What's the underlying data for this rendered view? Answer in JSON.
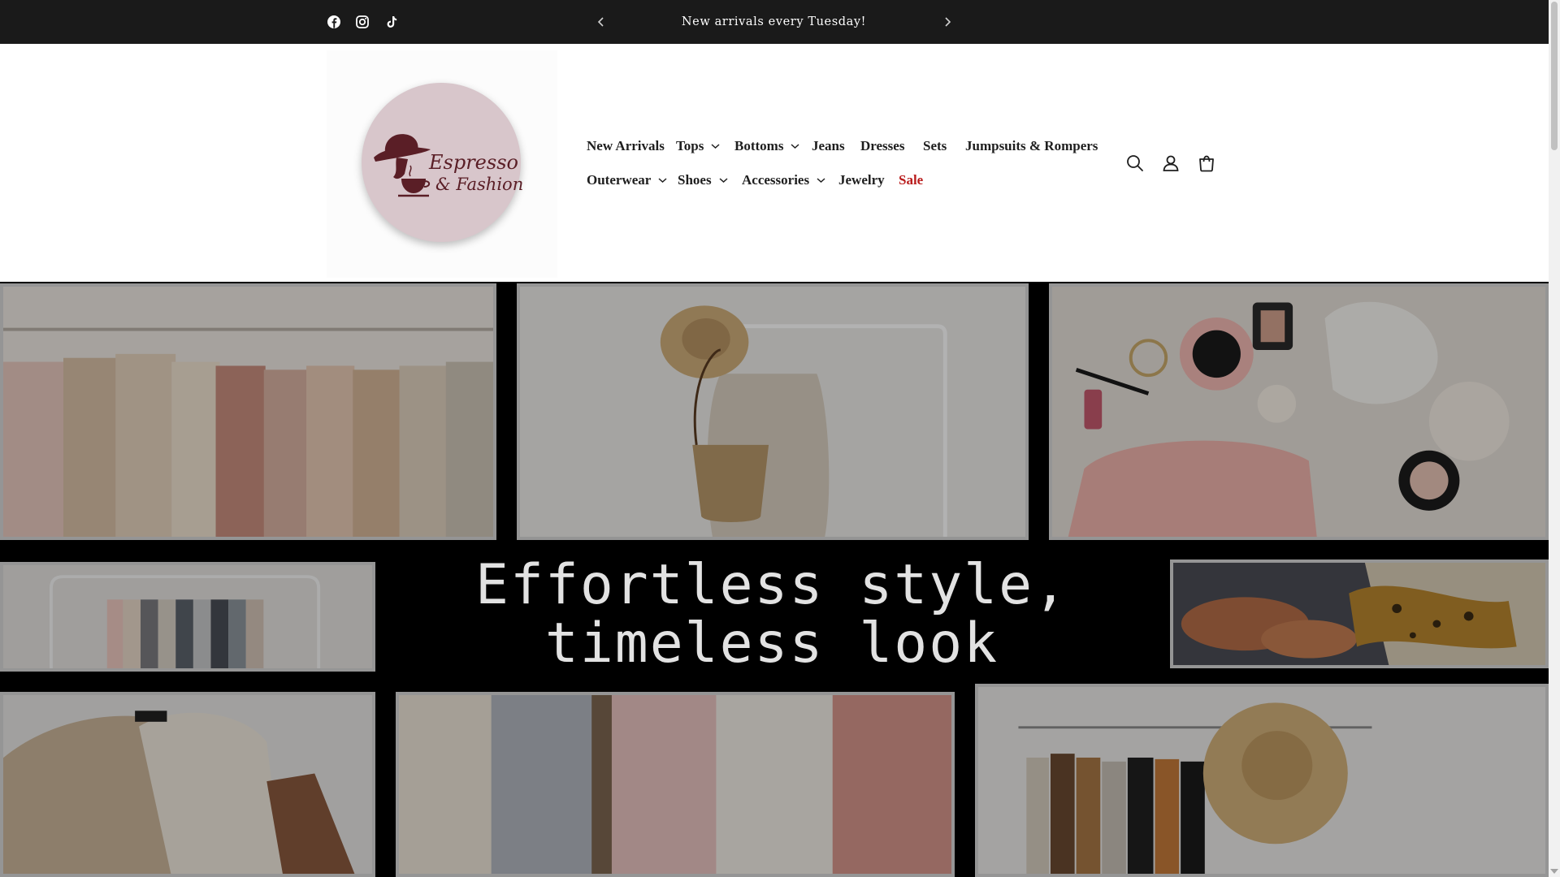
{
  "announcement": {
    "text": "New arrivals every Tuesday!",
    "social": [
      "facebook-icon",
      "instagram-icon",
      "tiktok-icon"
    ]
  },
  "logo": {
    "line1": "Espresso",
    "line2": "& Fashion",
    "badge_color": "#d8c6cb",
    "ink_color": "#5a1e26"
  },
  "nav": {
    "row1": [
      {
        "label": "New Arrivals",
        "dropdown": false
      },
      {
        "label": "Tops",
        "dropdown": true
      },
      {
        "label": "Bottoms",
        "dropdown": true
      },
      {
        "label": "Jeans",
        "dropdown": false
      },
      {
        "label": "Dresses",
        "dropdown": false
      },
      {
        "label": "Sets",
        "dropdown": false
      },
      {
        "label": "Jumpsuits & Rompers",
        "dropdown": false
      }
    ],
    "row2": [
      {
        "label": "Outerwear",
        "dropdown": true
      },
      {
        "label": "Shoes",
        "dropdown": true
      },
      {
        "label": "Accessories",
        "dropdown": true
      },
      {
        "label": "Jewelry",
        "dropdown": false
      },
      {
        "label": "Sale",
        "dropdown": false
      }
    ],
    "sale_color": "#b91c1c"
  },
  "header_icons": [
    "search-icon",
    "account-icon",
    "cart-icon"
  ],
  "hero": {
    "heading_line1": "Effortless style,",
    "heading_line2": "timeless look",
    "tiles": [
      "clothing-rack-photo",
      "hat-bag-dress-photo",
      "flatlay-coffee-photo",
      "hangers-rack-photo",
      "shoes-scarf-basket-photo",
      "houndstooth-coat-photo",
      "knit-sweaters-photo",
      "rack-with-hat-photo"
    ]
  }
}
